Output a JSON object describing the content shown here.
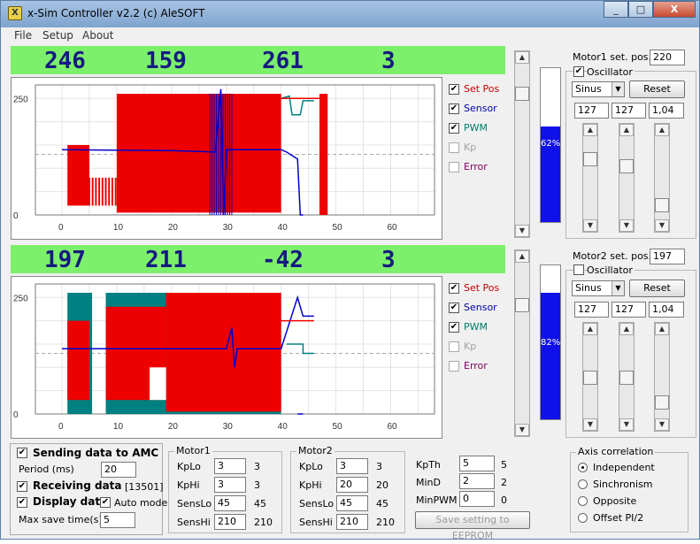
{
  "window": {
    "title": "x-Sim Controller v2.2 (c) AleSOFT",
    "minimize": "_",
    "maximize": "□",
    "close": "X"
  },
  "menu": [
    "File",
    "Setup",
    "About"
  ],
  "motor1": {
    "readout": [
      "246",
      "159",
      "261",
      "3"
    ],
    "legend": [
      {
        "label": "Set Pos",
        "checked": true,
        "color": "#cc0000"
      },
      {
        "label": "Sensor",
        "checked": true,
        "color": "#0000aa"
      },
      {
        "label": "PWM",
        "checked": true,
        "color": "#007a6a"
      },
      {
        "label": "Kp",
        "checked": false,
        "color": "#a0a0a0"
      },
      {
        "label": "Error",
        "checked": false,
        "color": "#800060"
      }
    ],
    "gauge_percent": 62,
    "gauge_label": "62%",
    "set_pos_label": "Motor1 set. pos.",
    "set_pos_value": "220",
    "oscillator_label": "Oscillator",
    "oscillator_checked": true,
    "wave": "Sinus",
    "reset_label": "Reset",
    "params": [
      "127",
      "127",
      "1,04"
    ]
  },
  "motor2": {
    "readout": [
      "197",
      "211",
      "-42",
      "3"
    ],
    "legend": [
      {
        "label": "Set Pos",
        "checked": true,
        "color": "#cc0000"
      },
      {
        "label": "Sensor",
        "checked": true,
        "color": "#0000aa"
      },
      {
        "label": "PWM",
        "checked": true,
        "color": "#007a6a"
      },
      {
        "label": "Kp",
        "checked": false,
        "color": "#a0a0a0"
      },
      {
        "label": "Error",
        "checked": false,
        "color": "#800060"
      }
    ],
    "gauge_percent": 82,
    "gauge_label": "82%",
    "set_pos_label": "Motor2 set. pos.",
    "set_pos_value": "197",
    "oscillator_label": "Oscillator",
    "oscillator_checked": false,
    "wave": "Sinus",
    "reset_label": "Reset",
    "params": [
      "127",
      "127",
      "1,04"
    ]
  },
  "chart_common": {
    "y_ticks": [
      "250",
      "0"
    ],
    "x_ticks": [
      "0",
      "10",
      "20",
      "30",
      "40",
      "50",
      "60"
    ]
  },
  "bottom": {
    "sending_label": "Sending data to AMC",
    "period_label": "Period (ms)",
    "period_value": "20",
    "receiving_label": "Receiving data",
    "receiving_count": "[13501]",
    "display_label": "Display data",
    "auto_mode_label": "Auto mode",
    "max_save_label": "Max save time(s)",
    "max_save_value": "5",
    "motor1_group": {
      "title": "Motor1",
      "rows": [
        {
          "label": "KpLo",
          "value": "3",
          "readout": "3"
        },
        {
          "label": "KpHi",
          "value": "3",
          "readout": "3"
        },
        {
          "label": "SensLo",
          "value": "45",
          "readout": "45"
        },
        {
          "label": "SensHi",
          "value": "210",
          "readout": "210"
        }
      ]
    },
    "motor2_group": {
      "title": "Motor2",
      "rows": [
        {
          "label": "KpLo",
          "value": "3",
          "readout": "3"
        },
        {
          "label": "KpHi",
          "value": "20",
          "readout": "20"
        },
        {
          "label": "SensLo",
          "value": "45",
          "readout": "45"
        },
        {
          "label": "SensHi",
          "value": "210",
          "readout": "210"
        }
      ]
    },
    "misc": [
      {
        "label": "KpTh",
        "value": "5",
        "readout": "5"
      },
      {
        "label": "MinD",
        "value": "2",
        "readout": "2"
      },
      {
        "label": "MinPWM",
        "value": "0",
        "readout": "0"
      }
    ],
    "eeprom_button": "Save setting to EEPROM",
    "axis_group": {
      "title": "Axis correlation",
      "options": [
        "Independent",
        "Sinchronism",
        "Opposite",
        "Offset PI/2"
      ],
      "selected": 0
    }
  }
}
